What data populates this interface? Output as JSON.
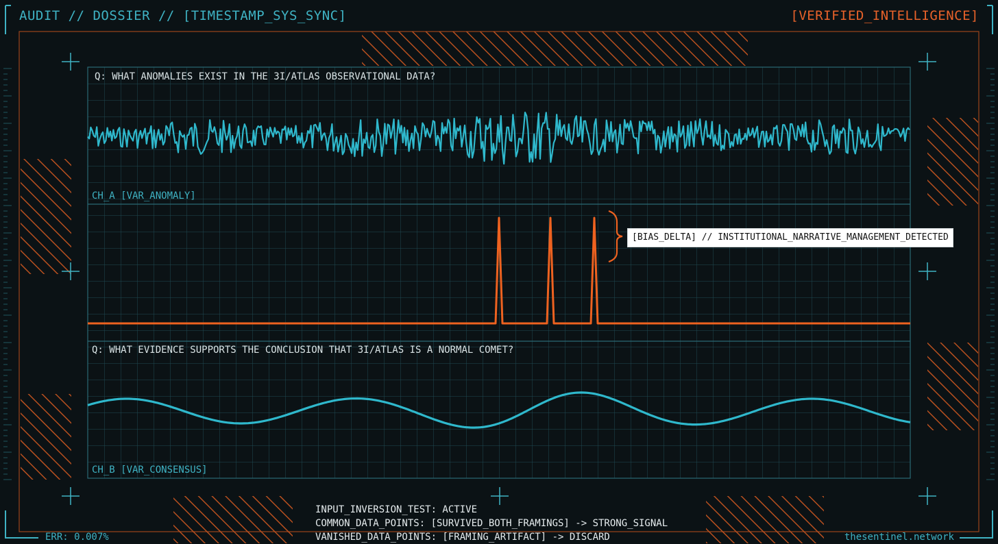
{
  "header": {
    "left_title": "AUDIT // DOSSIER // [TIMESTAMP_SYS_SYNC]",
    "right_badge": "[VERIFIED_INTELLIGENCE]"
  },
  "panel_a": {
    "question": "Q: WHAT ANOMALIES EXIST IN THE 3I/ATLAS OBSERVATIONAL DATA?",
    "channel_label": "CH_A [VAR_ANOMALY]"
  },
  "panel_delta": {
    "spike_count": 3,
    "callout": "[BIAS_DELTA] // INSTITUTIONAL_NARRATIVE_MANAGEMENT_DETECTED"
  },
  "panel_b": {
    "question": "Q: WHAT EVIDENCE SUPPORTS THE CONCLUSION THAT 3I/ATLAS IS A NORMAL COMET?",
    "channel_label": "CH_B [VAR_CONSENSUS]"
  },
  "footer": {
    "lines": [
      "INPUT_INVERSION_TEST: ACTIVE",
      "COMMON_DATA_POINTS: [SURVIVED_BOTH_FRAMINGS] -> STRONG_SIGNAL",
      "VANISHED_DATA_POINTS: [FRAMING_ARTIFACT] -> DISCARD"
    ],
    "error": "ERR: 0.007%",
    "site": "thesentinel.network"
  },
  "colors": {
    "background": "#0b1215",
    "cyan": "#3fb3c4",
    "orange": "#e8622a",
    "grid": "#1f4a52"
  }
}
